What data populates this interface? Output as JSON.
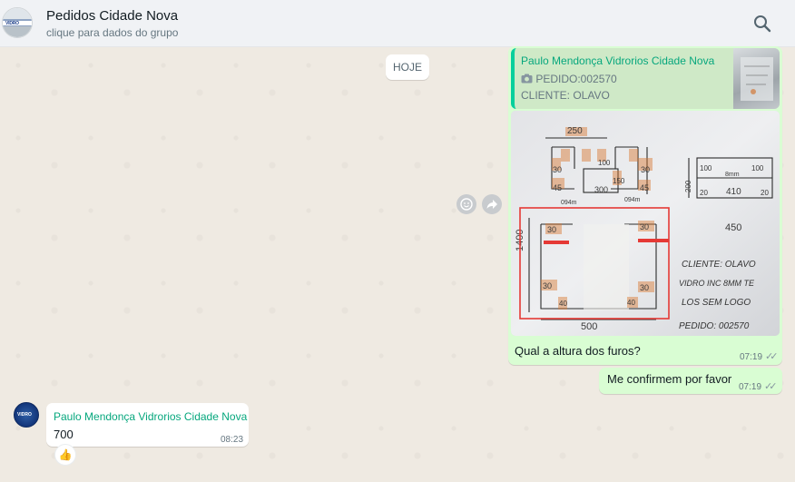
{
  "header": {
    "title": "Pedidos Cidade Nova",
    "subtitle": "clique para dados do grupo",
    "avatar_text": "VIDRO",
    "search_icon": "search-icon"
  },
  "date_chip": "HOJE",
  "outgoing_image": {
    "quote": {
      "author": "Paulo Mendonça Vidrorios Cidade Nova",
      "line1": "PEDIDO:002570",
      "line2": "CLIENTE: OLAVO",
      "icon": "camera-icon"
    },
    "sketch": {
      "t250": "250",
      "t30a": "30",
      "t30b": "30",
      "t100": "100",
      "t45a": "45",
      "t45b": "45",
      "t300": "300",
      "t150": "150",
      "t094a": "094m",
      "t094b": "094m",
      "t1400": "1400",
      "t30c": "30",
      "t30d": "30",
      "t30e": "30",
      "t30f": "30",
      "t40a": "40",
      "t40b": "40",
      "t500": "500",
      "r100a": "100",
      "r100b": "100",
      "r410": "410",
      "r20a": "20",
      "r20b": "20",
      "r8mm": "8mm",
      "r450": "450",
      "r200": "200",
      "note1": "CLIENTE: OLAVO",
      "note2": "VIDRO INC 8MM TE",
      "note3": "LOS SEM LOGO",
      "note4": "PEDIDO: 002570"
    },
    "caption": "Qual a altura dos furos?",
    "time": "07:19",
    "status_icon": "double-check-icon"
  },
  "side_actions": {
    "emoji_icon": "emoji-icon",
    "forward_icon": "forward-icon"
  },
  "outgoing_text": {
    "text": "Me confirmem por favor",
    "time": "07:19",
    "status_icon": "double-check-icon"
  },
  "incoming": {
    "author": "Paulo Mendonça Vidrorios Cidade Nova",
    "text": "700",
    "time": "08:23",
    "avatar_text": "VIDRO",
    "reaction": "👍"
  }
}
